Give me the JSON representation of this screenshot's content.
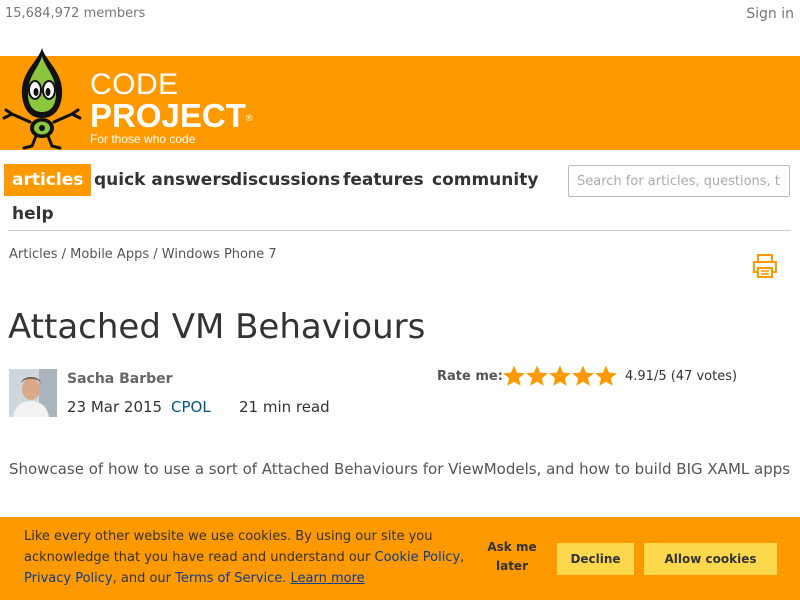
{
  "header": {
    "members_text": "15,684,972 members",
    "signin_label": "Sign in"
  },
  "logo": {
    "code": "CODE",
    "project": "PROJECT",
    "registered": "®",
    "tagline": "For those who code"
  },
  "nav": {
    "items": [
      {
        "label": "articles",
        "active": true
      },
      {
        "label": "quick answers",
        "active": false
      },
      {
        "label": "discussions",
        "active": false
      },
      {
        "label": "features",
        "active": false
      },
      {
        "label": "community",
        "active": false
      },
      {
        "label": "help",
        "active": false
      }
    ]
  },
  "search": {
    "placeholder": "Search for articles, questions, tips",
    "value": ""
  },
  "breadcrumb": {
    "items": [
      "Articles",
      "Mobile Apps",
      "Windows Phone 7"
    ],
    "separator": "/"
  },
  "article": {
    "title": "Attached VM Behaviours",
    "author": "Sacha Barber",
    "date": "23 Mar 2015",
    "license": "CPOL",
    "read_time": "21 min read",
    "summary": "Showcase of how to use a sort of Attached Behaviours for ViewModels, and how to build BIG XAML apps"
  },
  "rating": {
    "label": "Rate me:",
    "stars_shown": 5,
    "score_text": "4.91/5 (47 votes)"
  },
  "cookie": {
    "text_before": "Like every other website we use cookies. By using our site you acknowledge that you have read and understand our ",
    "cookie_policy": "Cookie Policy",
    "comma": ", ",
    "privacy_policy": "Privacy Policy",
    "and_our": ", and our ",
    "terms": "Terms of Service",
    "period": ". ",
    "learn_more": "Learn more",
    "ask_later": "Ask me later",
    "decline": "Decline",
    "allow": "Allow cookies"
  },
  "colors": {
    "brand_orange": "#ff9900",
    "button_yellow": "#fdd84d",
    "link_blue": "#005782",
    "star_orange": "#f90"
  },
  "icons": {
    "print": "print-icon",
    "star": "star-icon"
  }
}
